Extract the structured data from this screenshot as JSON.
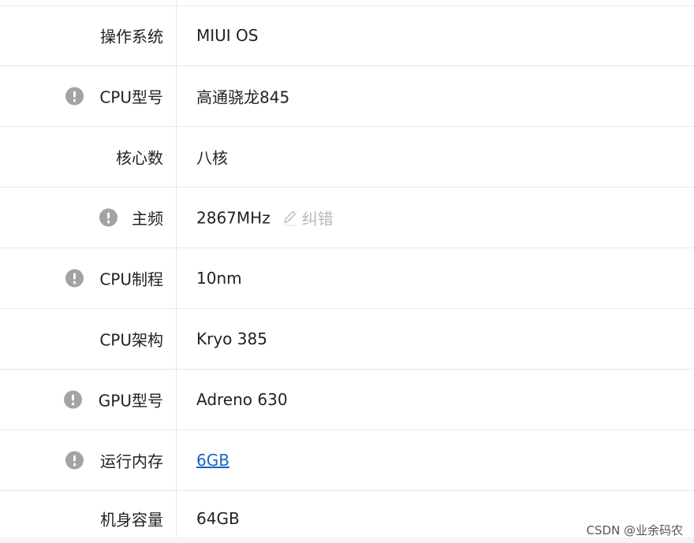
{
  "spec_rows": [
    {
      "label": "操作系统",
      "value": "MIUI OS",
      "has_info_icon": false
    },
    {
      "label": "CPU型号",
      "value": "高通骁龙845",
      "has_info_icon": true
    },
    {
      "label": "核心数",
      "value": "八核",
      "has_info_icon": false
    },
    {
      "label": "主频",
      "value": "2867MHz",
      "has_info_icon": true,
      "correction_label": "纠错"
    },
    {
      "label": "CPU制程",
      "value": "10nm",
      "has_info_icon": true
    },
    {
      "label": "CPU架构",
      "value": "Kryo 385",
      "has_info_icon": false
    },
    {
      "label": "GPU型号",
      "value": "Adreno 630",
      "has_info_icon": true
    },
    {
      "label": "运行内存",
      "value": "6GB",
      "has_info_icon": true,
      "value_is_link": true
    },
    {
      "label": "机身容量",
      "value": "64GB",
      "has_info_icon": false
    }
  ],
  "watermark": "CSDN @业余码农",
  "colors": {
    "label_text": "#222222",
    "info_icon": "#a3a3a3",
    "link": "#1764c8",
    "correction": "#b8b8b8",
    "divider": "#e8e8e8"
  },
  "icons": {
    "info": "exclamation-circle-icon",
    "correction": "pencil-icon"
  }
}
